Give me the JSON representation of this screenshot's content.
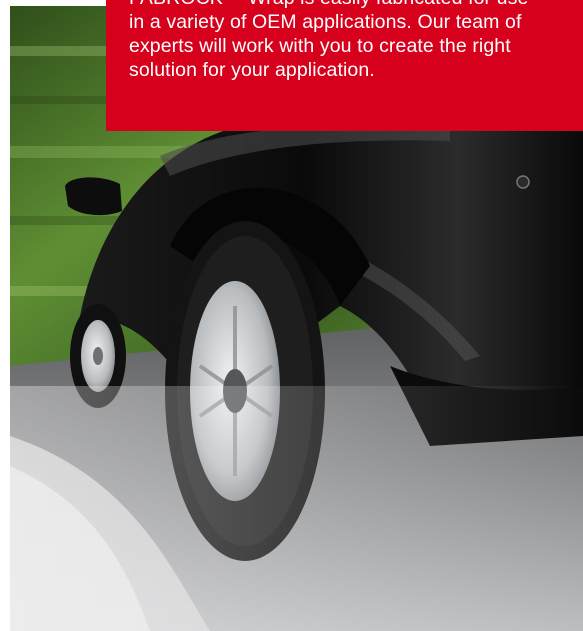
{
  "callout": {
    "text": "FABROCK™ Wrap is easily fabricated for use\nin a variety of OEM applications. Our team of\nexperts will work with you to create the right\nsolution for your application.",
    "background": "#d6001c",
    "text_color": "#ffffff"
  },
  "hero": {
    "subject": "black-car-cornering-on-road",
    "colors": {
      "foliage": "#4f7a2a",
      "road": "#7a7a7a",
      "car_body": "#111111",
      "wheel": "#bfc3c6"
    }
  }
}
